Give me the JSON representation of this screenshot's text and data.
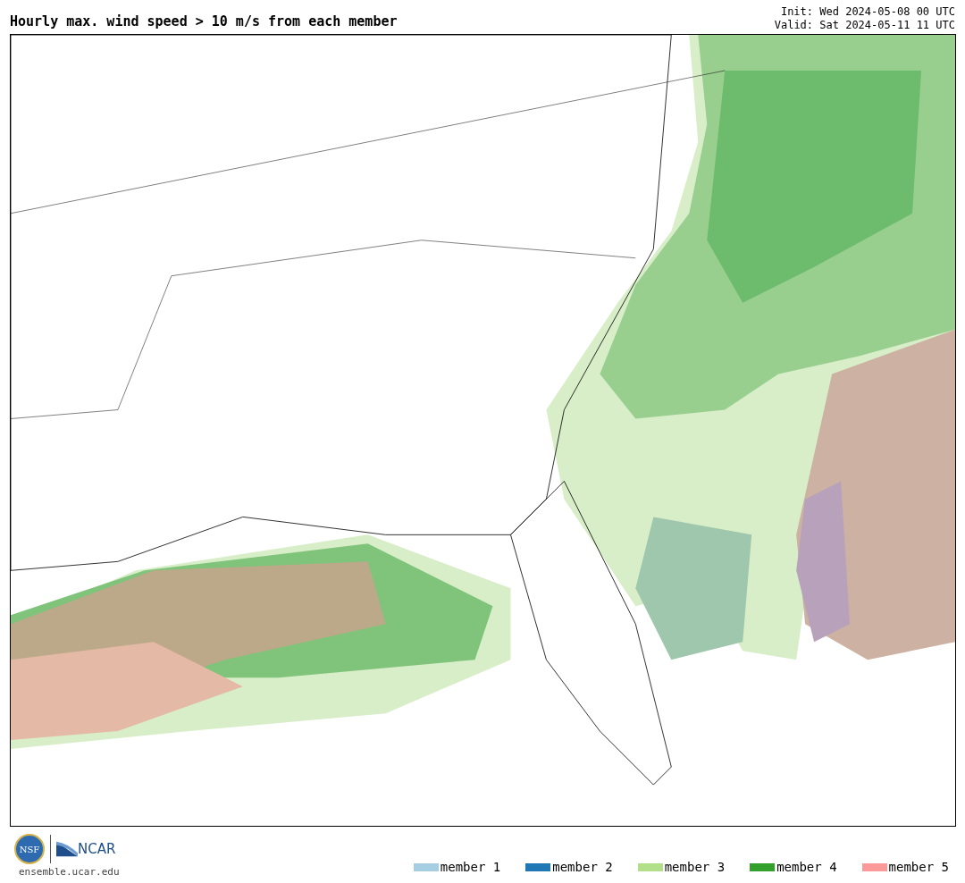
{
  "title": "Hourly max. wind speed > 10 m/s from each member",
  "init": "Init: Wed 2024-05-08 00 UTC",
  "valid": "Valid: Sat 2024-05-11 11 UTC",
  "logos": {
    "nsf": "NSF",
    "ncar": "NCAR"
  },
  "site": "ensemble.ucar.edu",
  "legend": [
    {
      "label": "member 1",
      "color": "#a6cee3"
    },
    {
      "label": "member 2",
      "color": "#1f78b4"
    },
    {
      "label": "member 3",
      "color": "#b2df8a"
    },
    {
      "label": "member 4",
      "color": "#33a02c"
    },
    {
      "label": "member 5",
      "color": "#fb9a99"
    }
  ]
}
